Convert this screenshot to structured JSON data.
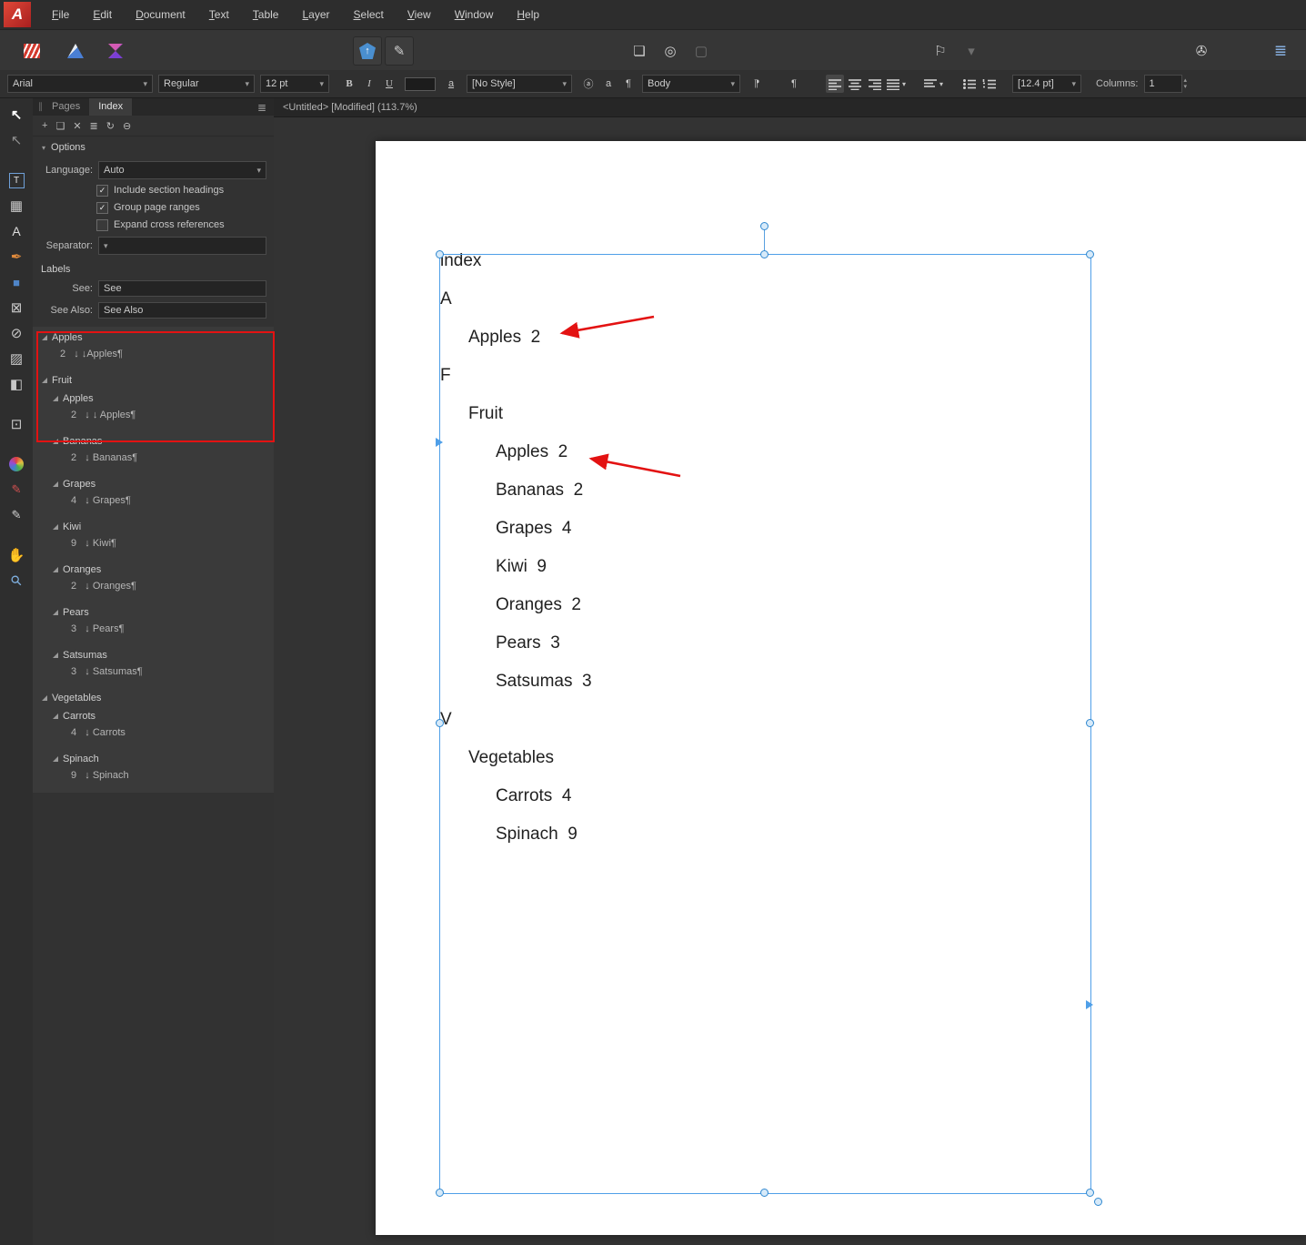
{
  "app": {
    "doc_tab_title": "<Untitled> [Modified] (113.7%)"
  },
  "menubar": {
    "items": [
      "File",
      "Edit",
      "Document",
      "Text",
      "Table",
      "Layer",
      "Select",
      "View",
      "Window",
      "Help"
    ]
  },
  "context_toolbar": {
    "font_family": "Arial",
    "font_style": "Regular",
    "font_size": "12 pt",
    "bold": "B",
    "italic": "I",
    "underline": "U",
    "underline_char": "a",
    "char_style": "[No Style]",
    "circled_a": "ⓐ",
    "small_a": "a",
    "pilcrow": "¶",
    "pilcrow_reverse": "¶",
    "para_style": "Body",
    "leading": "[12.4 pt]",
    "columns_label": "Columns:",
    "columns_value": "1"
  },
  "panel": {
    "tabs": {
      "pages": "Pages",
      "index": "Index"
    },
    "options_header": "Options",
    "language_label": "Language:",
    "language_value": "Auto",
    "checkboxes": [
      {
        "label": "Include section headings",
        "checked": true
      },
      {
        "label": "Group page ranges",
        "checked": true
      },
      {
        "label": "Expand cross references",
        "checked": false
      }
    ],
    "separator_label": "Separator:",
    "labels_header": "Labels",
    "see_label": "See:",
    "see_value": "See",
    "see_also_label": "See Also:",
    "see_also_value": "See Also",
    "tree": [
      {
        "type": "topic",
        "level": 0,
        "label": "Apples"
      },
      {
        "type": "ref",
        "level": 0,
        "label": "2   ↓ ↓Apples¶"
      },
      {
        "type": "topic",
        "level": 0,
        "label": "Fruit"
      },
      {
        "type": "topic",
        "level": 1,
        "label": "Apples"
      },
      {
        "type": "ref",
        "level": 1,
        "label": "2   ↓ ↓ Apples¶"
      },
      {
        "type": "topic",
        "level": 1,
        "label": "Bananas"
      },
      {
        "type": "ref",
        "level": 1,
        "label": "2   ↓ Bananas¶"
      },
      {
        "type": "topic",
        "level": 1,
        "label": "Grapes"
      },
      {
        "type": "ref",
        "level": 1,
        "label": "4   ↓ Grapes¶"
      },
      {
        "type": "topic",
        "level": 1,
        "label": "Kiwi"
      },
      {
        "type": "ref",
        "level": 1,
        "label": "9   ↓ Kiwi¶"
      },
      {
        "type": "topic",
        "level": 1,
        "label": "Oranges"
      },
      {
        "type": "ref",
        "level": 1,
        "label": "2   ↓ Oranges¶"
      },
      {
        "type": "topic",
        "level": 1,
        "label": "Pears"
      },
      {
        "type": "ref",
        "level": 1,
        "label": "3   ↓ Pears¶"
      },
      {
        "type": "topic",
        "level": 1,
        "label": "Satsumas"
      },
      {
        "type": "ref",
        "level": 1,
        "label": "3   ↓ Satsumas¶"
      },
      {
        "type": "topic",
        "level": 0,
        "label": "Vegetables"
      },
      {
        "type": "topic",
        "level": 1,
        "label": "Carrots"
      },
      {
        "type": "ref",
        "level": 1,
        "label": "4   ↓ Carrots"
      },
      {
        "type": "topic",
        "level": 1,
        "label": "Spinach"
      },
      {
        "type": "ref",
        "level": 1,
        "label": "9   ↓ Spinach"
      }
    ]
  },
  "document": {
    "lines": [
      {
        "indent": 0,
        "text": "index"
      },
      {
        "indent": 0,
        "text": "A"
      },
      {
        "indent": 1,
        "text": "Apples  2"
      },
      {
        "indent": 0,
        "text": "F"
      },
      {
        "indent": 1,
        "text": "Fruit"
      },
      {
        "indent": 2,
        "text": "Apples  2"
      },
      {
        "indent": 2,
        "text": "Bananas  2"
      },
      {
        "indent": 2,
        "text": "Grapes  4"
      },
      {
        "indent": 2,
        "text": "Kiwi  9"
      },
      {
        "indent": 2,
        "text": "Oranges  2"
      },
      {
        "indent": 2,
        "text": "Pears  3"
      },
      {
        "indent": 2,
        "text": "Satsumas  3"
      },
      {
        "indent": 0,
        "text": "V"
      },
      {
        "indent": 1,
        "text": "Vegetables"
      },
      {
        "indent": 2,
        "text": "Carrots  4"
      },
      {
        "indent": 2,
        "text": "Spinach  9"
      }
    ]
  },
  "icons": {
    "logo": "A",
    "grip": "∥",
    "panel_menu": "≣",
    "add": "+",
    "insert_page": "❏",
    "delete": "✕",
    "list": "≣",
    "refresh": "↻",
    "link": "⊖",
    "combo_arrow": "▾",
    "spin_up": "▴",
    "spin_down": "▾",
    "move": "↖",
    "node": "↖",
    "frame_text": "T",
    "table": "▦",
    "artistic_text": "A",
    "pen": "✒",
    "shape": "■",
    "picture_frame": "⊠",
    "ellipse_frame": "⊘",
    "place_image": "▨",
    "transparency": "◧",
    "crop": "⊡",
    "picker": "✎",
    "hand": "✋",
    "zoom": "⚲",
    "home_arrow": "↑",
    "pencil": "✎",
    "page": "❏",
    "ring": "◎",
    "empty_square": "▢",
    "flag": "⚐",
    "tape": "✇",
    "hamburger": "≣"
  },
  "colors": {
    "selection_blue": "#3f95e0",
    "annotation_red": "#e31212"
  }
}
